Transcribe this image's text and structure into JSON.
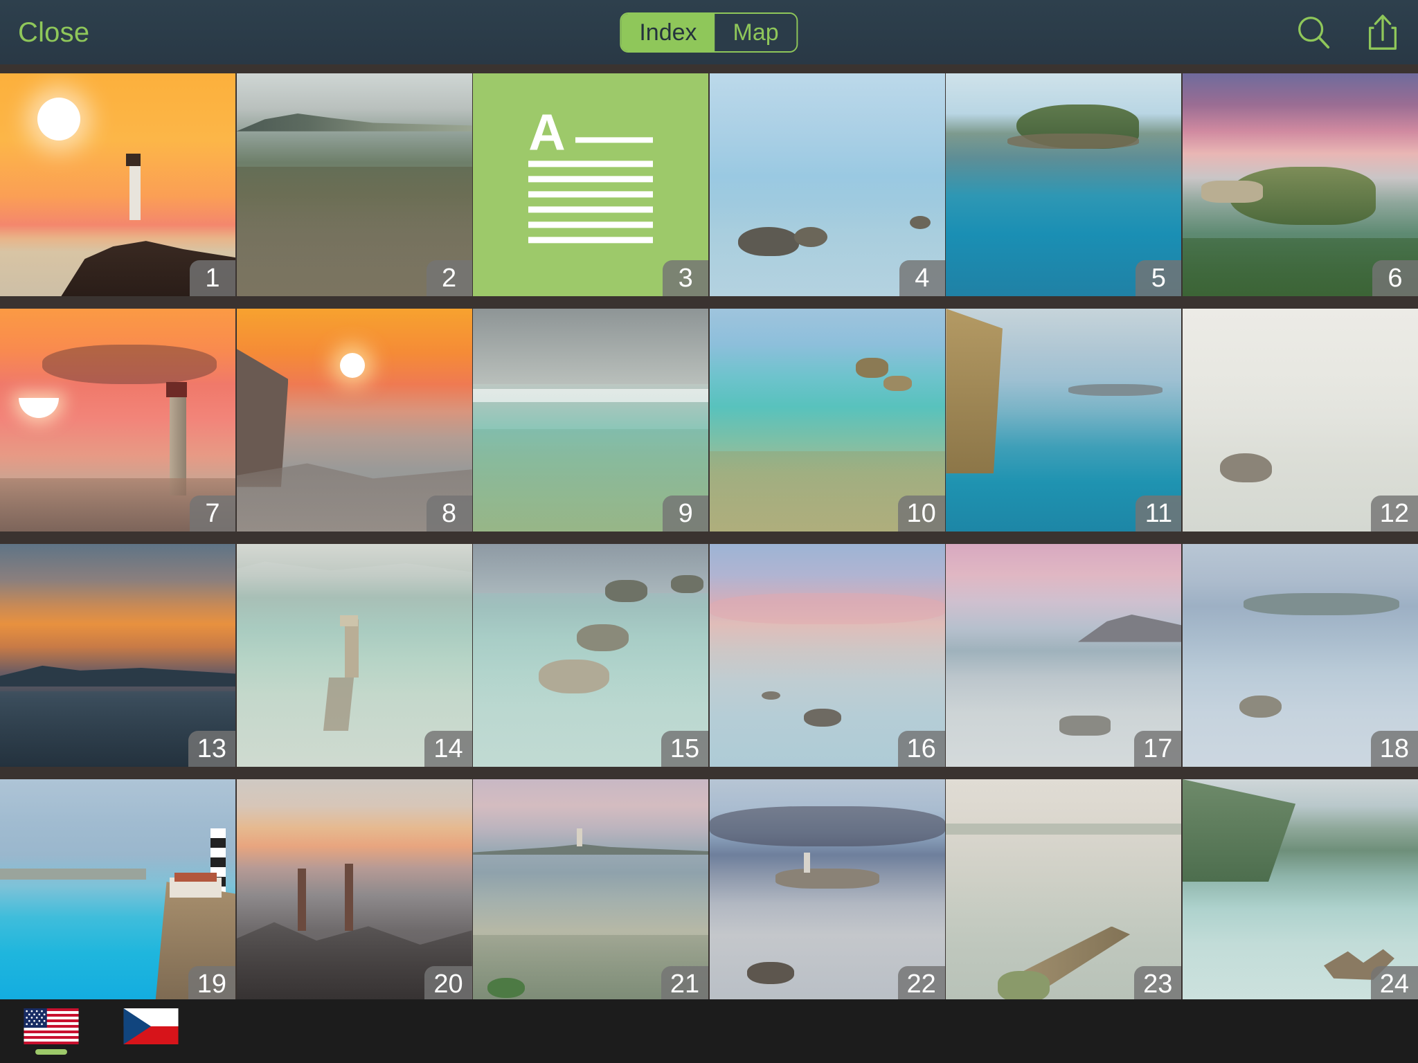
{
  "header": {
    "close_label": "Close",
    "segmented": {
      "options": [
        "Index",
        "Map"
      ],
      "selected": "Index"
    },
    "search_icon": "search-icon",
    "share_icon": "share-icon",
    "accent_color": "#8fc75a",
    "background_color": "#2b3c49"
  },
  "grid": {
    "columns": 6,
    "rows": 4,
    "total_items": 24,
    "items": [
      {
        "number": "1",
        "kind": "photo",
        "caption": "Lighthouse on cliff at orange sunset with large white sun"
      },
      {
        "number": "2",
        "kind": "photo",
        "caption": "Rocky headland and sea at sunset with distant island"
      },
      {
        "number": "3",
        "kind": "text-article",
        "caption": "Green text article placeholder with letter A and lines"
      },
      {
        "number": "4",
        "kind": "photo",
        "caption": "Calm blue sea with dark rocks and pale blue sky"
      },
      {
        "number": "5",
        "kind": "photo",
        "caption": "Turquoise cove with green rocky island"
      },
      {
        "number": "6",
        "kind": "photo",
        "caption": "Purple and pink sunset clouds over green headland cove"
      },
      {
        "number": "7",
        "kind": "photo",
        "caption": "Red lighthouse on breakwater at fiery orange sunset"
      },
      {
        "number": "8",
        "kind": "photo",
        "caption": "Cliff silhouette and sun setting over orange sea"
      },
      {
        "number": "9",
        "kind": "photo",
        "caption": "Overcast sky over shallow turquoise reef"
      },
      {
        "number": "10",
        "kind": "photo",
        "caption": "Aerial turquoise reef shallows with small rocks"
      },
      {
        "number": "11",
        "kind": "photo",
        "caption": "Golden cliff beside deep teal water and distant island"
      },
      {
        "number": "12",
        "kind": "photo",
        "caption": "High-key pale minimal seascape with a single rock"
      },
      {
        "number": "13",
        "kind": "photo",
        "caption": "Dusk harbour silhouette with orange sky band"
      },
      {
        "number": "14",
        "kind": "photo",
        "caption": "Old wooden jetty in milky pale green water"
      },
      {
        "number": "15",
        "kind": "photo",
        "caption": "Long exposure boulders in pale mint sea"
      },
      {
        "number": "16",
        "kind": "photo",
        "caption": "Pink clouded sky over still sea with single rock"
      },
      {
        "number": "17",
        "kind": "photo",
        "caption": "Pink and lilac pastel sunset over headland"
      },
      {
        "number": "18",
        "kind": "photo",
        "caption": "Soft blue misty island with foreground rocks"
      },
      {
        "number": "19",
        "kind": "photo",
        "caption": "Striped lighthouse on cliff above bright turquoise bay"
      },
      {
        "number": "20",
        "kind": "photo",
        "caption": "Wooden posts in misty rock pools at dusk"
      },
      {
        "number": "21",
        "kind": "photo",
        "caption": "Distant lighthouse island with mossy rock foreground"
      },
      {
        "number": "22",
        "kind": "photo",
        "caption": "Blue hour lighthouse on small island with dark clouds"
      },
      {
        "number": "23",
        "kind": "photo",
        "caption": "Foggy pale seascape with wooden pier into water"
      },
      {
        "number": "24",
        "kind": "photo",
        "caption": "Green headland with driftwood in shallow turquoise water"
      }
    ]
  },
  "bottom_bar": {
    "languages": [
      {
        "name": "en-US",
        "flag": "us-flag-icon",
        "selected": true
      },
      {
        "name": "cs-CZ",
        "flag": "cz-flag-icon",
        "selected": false
      }
    ],
    "indicator_color": "#9dc96a",
    "background_color": "#1c1c1c"
  }
}
